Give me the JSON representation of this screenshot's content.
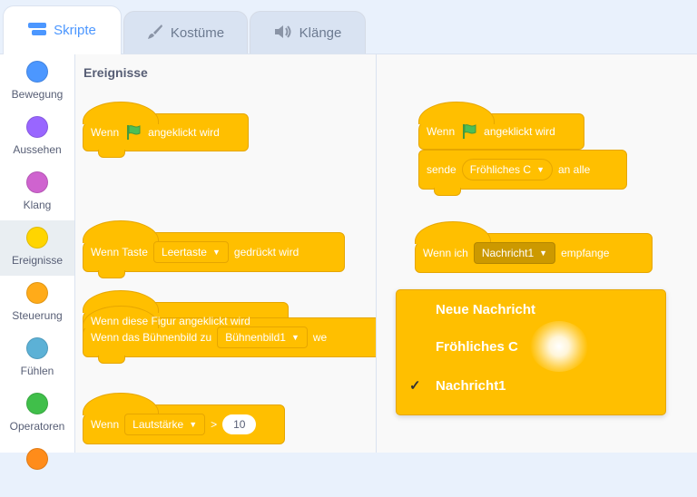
{
  "tabs": [
    {
      "label": "Skripte",
      "icon": "code-icon"
    },
    {
      "label": "Kostüme",
      "icon": "brush-icon"
    },
    {
      "label": "Klänge",
      "icon": "speaker-icon"
    }
  ],
  "categories": [
    {
      "label": "Bewegung",
      "color": "#4c97ff"
    },
    {
      "label": "Aussehen",
      "color": "#9966ff"
    },
    {
      "label": "Klang",
      "color": "#cf63cf"
    },
    {
      "label": "Ereignisse",
      "color": "#ffd500"
    },
    {
      "label": "Steuerung",
      "color": "#ffab19"
    },
    {
      "label": "Fühlen",
      "color": "#5cb1d6"
    },
    {
      "label": "Operatoren",
      "color": "#40bf4a"
    }
  ],
  "palette": {
    "title": "Ereignisse",
    "flag_block": {
      "prefix": "Wenn",
      "suffix": "angeklickt wird"
    },
    "key_block": {
      "prefix": "Wenn Taste",
      "dropdown": "Leertaste",
      "suffix": "gedrückt wird"
    },
    "sprite_block": {
      "label": "Wenn diese Figur angeklickt wird"
    },
    "backdrop_block": {
      "prefix": "Wenn das Bühnenbild zu",
      "dropdown": "Bühnenbild1",
      "suffix": "we"
    },
    "loudness_block": {
      "prefix": "Wenn",
      "dropdown": "Lautstärke",
      "operator": ">",
      "value": "10"
    }
  },
  "script": {
    "flag_block": {
      "prefix": "Wenn",
      "suffix": "angeklickt wird"
    },
    "broadcast_block": {
      "prefix": "sende",
      "dropdown": "Fröhliches C",
      "suffix": "an alle"
    },
    "receive_block": {
      "prefix": "Wenn ich",
      "dropdown": "Nachricht1",
      "suffix": "empfange"
    }
  },
  "dropdown_menu": {
    "items": [
      {
        "label": "Neue Nachricht",
        "checked": false
      },
      {
        "label": "Fröhliches C",
        "checked": false
      },
      {
        "label": "Nachricht1",
        "checked": true
      }
    ],
    "check_glyph": "✓"
  },
  "colors": {
    "events": "#ffbf00",
    "accent": "#4c97ff"
  }
}
